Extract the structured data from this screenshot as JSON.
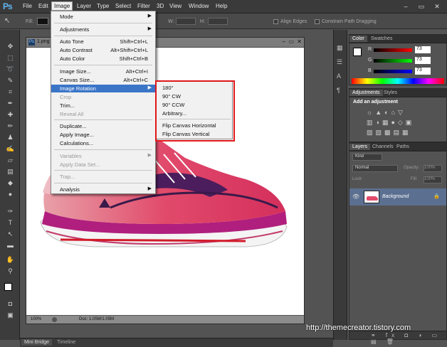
{
  "app": {
    "logo": "Ps"
  },
  "menubar": {
    "items": [
      "File",
      "Edit",
      "Image",
      "Layer",
      "Type",
      "Select",
      "Filter",
      "3D",
      "View",
      "Window",
      "Help"
    ],
    "window_buttons": [
      "–",
      "▭",
      "✕"
    ]
  },
  "options_bar": {
    "fill_label": "Fill:",
    "align_edges": "Align Edges",
    "constrain_path": "Constrain Path Dragging",
    "w_label": "W:",
    "h_label": "H:"
  },
  "document": {
    "tab_title": "1.png",
    "zoom": "100%",
    "doc_size": "Doc: 1.05M/1.05M"
  },
  "image_menu": {
    "mode": "Mode",
    "adjustments": "Adjustments",
    "auto_tone": {
      "label": "Auto Tone",
      "shortcut": "Shift+Ctrl+L"
    },
    "auto_contrast": {
      "label": "Auto Contrast",
      "shortcut": "Alt+Shift+Ctrl+L"
    },
    "auto_color": {
      "label": "Auto Color",
      "shortcut": "Shift+Ctrl+B"
    },
    "image_size": {
      "label": "Image Size...",
      "shortcut": "Alt+Ctrl+I"
    },
    "canvas_size": {
      "label": "Canvas Size...",
      "shortcut": "Alt+Ctrl+C"
    },
    "image_rotation": "Image Rotation",
    "crop": "Crop",
    "trim": "Trim...",
    "reveal_all": "Reveal All",
    "duplicate": "Duplicate...",
    "apply_image": "Apply Image...",
    "calculations": "Calculations...",
    "variables": "Variables",
    "apply_data_set": "Apply Data Set...",
    "trap": "Trap...",
    "analysis": "Analysis"
  },
  "rotation_submenu": [
    "180°",
    "90° CW",
    "90° CCW",
    "Arbitrary...",
    "Flip Canvas Horizontal",
    "Flip Canvas Vertical"
  ],
  "panels": {
    "color_tabs": [
      "Color",
      "Swatches"
    ],
    "color_values": {
      "r": "73",
      "g": "73",
      "b": "73"
    },
    "color_letters": {
      "r": "R",
      "g": "G",
      "b": "B"
    },
    "adjust_tabs": [
      "Adjustments",
      "Styles"
    ],
    "add_adjustment": "Add an adjustment",
    "layers_tabs": [
      "Layers",
      "Channels",
      "Paths"
    ],
    "kind": "Kind",
    "blend_mode": "Normal",
    "opacity_label": "Opacity:",
    "opacity_value": "100%",
    "lock_label": "Lock:",
    "fill_label": "Fill:",
    "fill_value": "100%",
    "layer_name": "Background"
  },
  "bottom_tabs": [
    "Mini Bridge",
    "Timeline"
  ],
  "watermark": "http://themecreator.tistory.com",
  "colors": {
    "accent": "#3b75c8",
    "highlight_box": "#e0171a",
    "logo": "#5fb4ef"
  }
}
